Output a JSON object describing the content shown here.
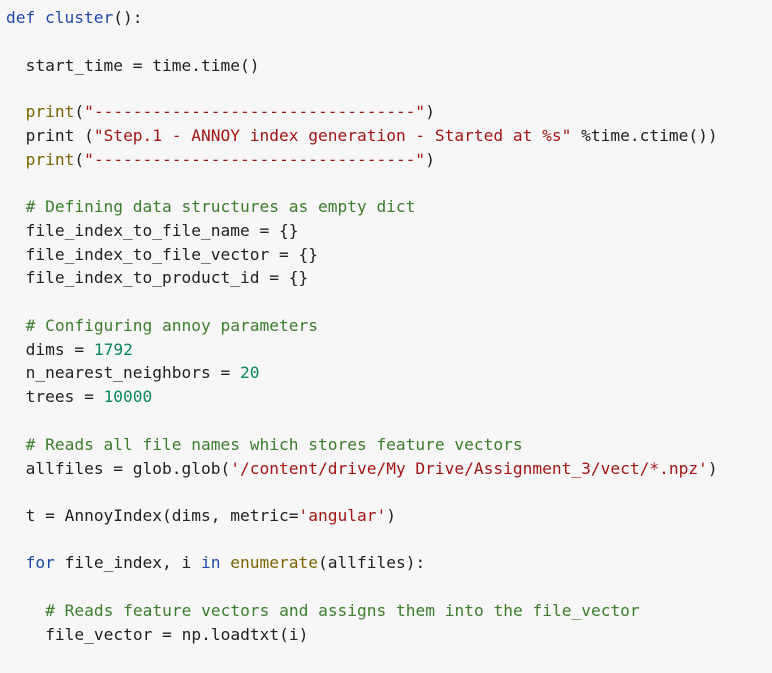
{
  "editor": {
    "lines": [
      {
        "indent": 0,
        "segments": [
          {
            "cls": "kw",
            "text": "def"
          },
          {
            "cls": "plain",
            "text": " "
          },
          {
            "cls": "fn",
            "text": "cluster"
          },
          {
            "cls": "plain",
            "text": "():"
          }
        ]
      },
      {
        "indent": 2,
        "segments": [
          {
            "cls": "plain",
            "text": "start_time = time.time()"
          }
        ]
      },
      {
        "indent": 2,
        "segments": [
          {
            "cls": "builtin",
            "text": "print"
          },
          {
            "cls": "plain",
            "text": "("
          },
          {
            "cls": "str",
            "text": "\"---------------------------------\""
          },
          {
            "cls": "plain",
            "text": ")"
          }
        ]
      },
      {
        "indent": 2,
        "segments": [
          {
            "cls": "plain",
            "text": "print ("
          },
          {
            "cls": "str",
            "text": "\"Step.1 - ANNOY index generation - Started at %s\""
          },
          {
            "cls": "plain",
            "text": " %time.ctime())"
          }
        ]
      },
      {
        "indent": 2,
        "segments": [
          {
            "cls": "builtin",
            "text": "print"
          },
          {
            "cls": "plain",
            "text": "("
          },
          {
            "cls": "str",
            "text": "\"---------------------------------\""
          },
          {
            "cls": "plain",
            "text": ")"
          }
        ]
      },
      {
        "indent": 2,
        "segments": [
          {
            "cls": "cmt",
            "text": "# Defining data structures as empty dict"
          }
        ]
      },
      {
        "indent": 2,
        "segments": [
          {
            "cls": "plain",
            "text": "file_index_to_file_name = {}"
          }
        ]
      },
      {
        "indent": 2,
        "segments": [
          {
            "cls": "plain",
            "text": "file_index_to_file_vector = {}"
          }
        ]
      },
      {
        "indent": 2,
        "segments": [
          {
            "cls": "plain",
            "text": "file_index_to_product_id = {}"
          }
        ]
      },
      {
        "indent": 2,
        "segments": [
          {
            "cls": "cmt",
            "text": "# Configuring annoy parameters"
          }
        ]
      },
      {
        "indent": 2,
        "segments": [
          {
            "cls": "plain",
            "text": "dims = "
          },
          {
            "cls": "num",
            "text": "1792"
          }
        ]
      },
      {
        "indent": 2,
        "segments": [
          {
            "cls": "plain",
            "text": "n_nearest_neighbors = "
          },
          {
            "cls": "num",
            "text": "20"
          }
        ]
      },
      {
        "indent": 2,
        "segments": [
          {
            "cls": "plain",
            "text": "trees = "
          },
          {
            "cls": "num",
            "text": "10000"
          }
        ]
      },
      {
        "indent": 2,
        "segments": [
          {
            "cls": "cmt",
            "text": "# Reads all file names which stores feature vectors"
          }
        ]
      },
      {
        "indent": 2,
        "segments": [
          {
            "cls": "plain",
            "text": "allfiles = glob.glob("
          },
          {
            "cls": "str",
            "text": "'/content/drive/My Drive/Assignment_3/vect/*.npz'"
          },
          {
            "cls": "plain",
            "text": ")"
          }
        ]
      },
      {
        "indent": 2,
        "segments": [
          {
            "cls": "plain",
            "text": "t = AnnoyIndex(dims, metric="
          },
          {
            "cls": "str",
            "text": "'angular'"
          },
          {
            "cls": "plain",
            "text": ")"
          }
        ]
      },
      {
        "indent": 2,
        "segments": [
          {
            "cls": "kw",
            "text": "for"
          },
          {
            "cls": "plain",
            "text": " file_index, i "
          },
          {
            "cls": "kw",
            "text": "in"
          },
          {
            "cls": "plain",
            "text": " "
          },
          {
            "cls": "builtin",
            "text": "enumerate"
          },
          {
            "cls": "plain",
            "text": "(allfiles):"
          }
        ]
      },
      {
        "indent": 4,
        "segments": [
          {
            "cls": "cmt",
            "text": "# Reads feature vectors and assigns them into the file_vector"
          }
        ]
      },
      {
        "indent": 4,
        "segments": [
          {
            "cls": "plain",
            "text": "file_vector = np.loadtxt(i)"
          }
        ]
      }
    ]
  }
}
